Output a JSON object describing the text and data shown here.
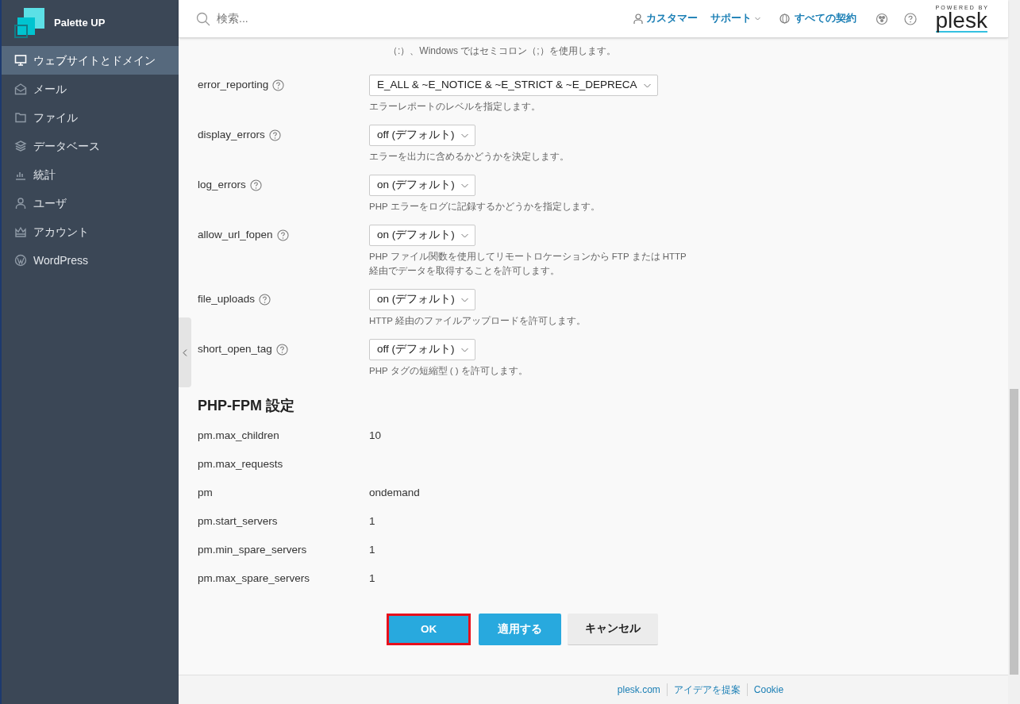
{
  "brand": {
    "name": "Palette UP"
  },
  "sidebar": {
    "items": [
      {
        "label": "ウェブサイトとドメイン",
        "selected": true
      },
      {
        "label": "メール",
        "selected": false
      },
      {
        "label": "ファイル",
        "selected": false
      },
      {
        "label": "データベース",
        "selected": false
      },
      {
        "label": "統計",
        "selected": false
      },
      {
        "label": "ユーザ",
        "selected": false
      },
      {
        "label": "アカウント",
        "selected": false
      },
      {
        "label": "WordPress",
        "selected": false
      }
    ]
  },
  "header": {
    "search": {
      "placeholder": "検索..."
    },
    "user": "カスタマー",
    "support": "サポート",
    "subscriptions": "すべての契約",
    "powered_by": "POWERED BY",
    "logo": "plesk"
  },
  "intro_text": [
    "（:）、Windows ではセミコロン（;）を使用します。"
  ],
  "settings": [
    {
      "name": "error_reporting",
      "kind": "select",
      "value": "E_ALL & ~E_NOTICE & ~E_STRICT & ~E_DEPRECA",
      "description": "エラーレポートのレベルを指定します。"
    },
    {
      "name": "display_errors",
      "kind": "select",
      "value": "off (デフォルト)",
      "description": "エラーを出力に含めるかどうかを決定します。"
    },
    {
      "name": "log_errors",
      "kind": "select",
      "value": "on (デフォルト)",
      "description": "PHP エラーをログに記録するかどうかを指定します。"
    },
    {
      "name": "allow_url_fopen",
      "kind": "select",
      "value": "on (デフォルト)",
      "description": "PHP ファイル関数を使用してリモートロケーションから FTP または HTTP 経由でデータを取得することを許可します。"
    },
    {
      "name": "file_uploads",
      "kind": "select",
      "value": "on (デフォルト)",
      "description": "HTTP 経由のファイルアップロードを許可します。"
    },
    {
      "name": "short_open_tag",
      "kind": "select",
      "value": "off (デフォルト)",
      "description": "PHP タグの短縮型 ( ) を許可します。"
    }
  ],
  "fpm": {
    "title": "PHP-FPM 設定",
    "rows": [
      {
        "name": "pm.max_children",
        "value": "10"
      },
      {
        "name": "pm.max_requests"
      },
      {
        "name": "pm",
        "value": "ondemand"
      },
      {
        "name": "pm.start_servers",
        "value": "1"
      },
      {
        "name": "pm.min_spare_servers",
        "value": "1"
      },
      {
        "name": "pm.max_spare_servers",
        "value": "1"
      }
    ]
  },
  "buttons": [
    {
      "label": "OK",
      "kind": "primary",
      "highlighted": true
    },
    {
      "label": "適用する",
      "kind": "primary",
      "highlighted": false
    },
    {
      "label": "キャンセル",
      "kind": "secondary",
      "highlighted": false
    }
  ],
  "footer": {
    "links": [
      "plesk.com",
      "アイデアを提案",
      "Cookie"
    ]
  }
}
